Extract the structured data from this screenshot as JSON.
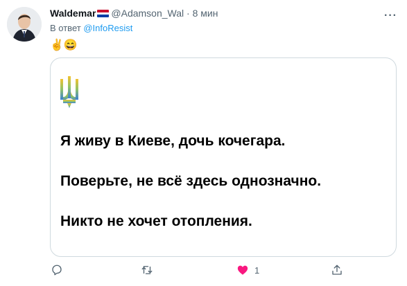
{
  "tweet": {
    "author_name": "Waldemar",
    "author_handle": "@Adamson_Wal",
    "separator": "·",
    "time": "8 мин",
    "reply_prefix": "В ответ",
    "reply_to": "@InfoResist",
    "emojis": "✌️😄",
    "more_label": "···"
  },
  "image_card": {
    "lines": [
      "Я живу в Киеве, дочь кочегара.",
      "Поверьте, не всё здесь однозначно.",
      "Никто не хочет отопления."
    ]
  },
  "actions": {
    "reply_count": "",
    "retweet_count": "",
    "like_count": "1",
    "like_color": "#f91880",
    "share_count": ""
  },
  "flag_colors": [
    "#c8102e",
    "#ffffff",
    "#003da5"
  ],
  "icons": [
    "avatar-photo",
    "flag-icon",
    "more-icon",
    "ukraine-trident-icon",
    "reply-icon",
    "retweet-icon",
    "heart-icon",
    "share-icon"
  ]
}
